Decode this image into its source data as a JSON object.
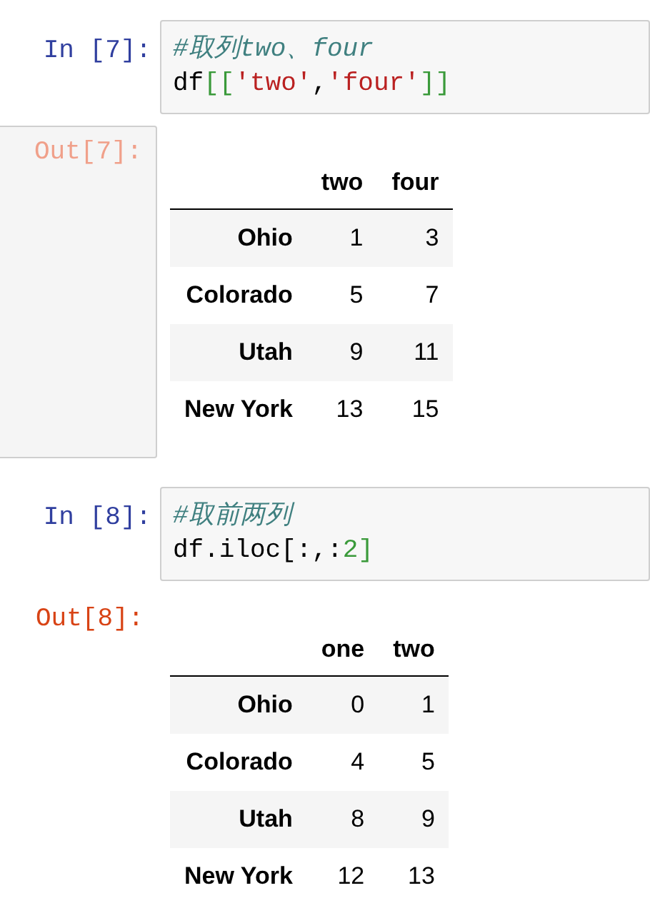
{
  "cells": [
    {
      "input_prompt": "In [7]:",
      "code": [
        [
          {
            "kind": "comment",
            "text": "#取列two、four"
          }
        ],
        [
          {
            "kind": "plain",
            "text": "df"
          },
          {
            "kind": "bracket",
            "text": "[["
          },
          {
            "kind": "string",
            "text": "'two'"
          },
          {
            "kind": "plain",
            "text": ","
          },
          {
            "kind": "string",
            "text": "'four'"
          },
          {
            "kind": "bracket",
            "text": "]]"
          }
        ]
      ],
      "output_prompt": "Out[7]:",
      "output_highlighted": true,
      "table": {
        "columns": [
          "two",
          "four"
        ],
        "rows": [
          {
            "index": "Ohio",
            "values": [
              "1",
              "3"
            ]
          },
          {
            "index": "Colorado",
            "values": [
              "5",
              "7"
            ]
          },
          {
            "index": "Utah",
            "values": [
              "9",
              "11"
            ]
          },
          {
            "index": "New York",
            "values": [
              "13",
              "15"
            ]
          }
        ]
      }
    },
    {
      "input_prompt": "In [8]:",
      "code": [
        [
          {
            "kind": "comment",
            "text": "#取前两列"
          }
        ],
        [
          {
            "kind": "plain",
            "text": "df.iloc[:,:"
          },
          {
            "kind": "number",
            "text": "2"
          },
          {
            "kind": "bracket",
            "text": "]"
          }
        ]
      ],
      "output_prompt": "Out[8]:",
      "output_highlighted": false,
      "table": {
        "columns": [
          "one",
          "two"
        ],
        "rows": [
          {
            "index": "Ohio",
            "values": [
              "0",
              "1"
            ]
          },
          {
            "index": "Colorado",
            "values": [
              "4",
              "5"
            ]
          },
          {
            "index": "Utah",
            "values": [
              "8",
              "9"
            ]
          },
          {
            "index": "New York",
            "values": [
              "12",
              "13"
            ]
          }
        ]
      }
    }
  ]
}
